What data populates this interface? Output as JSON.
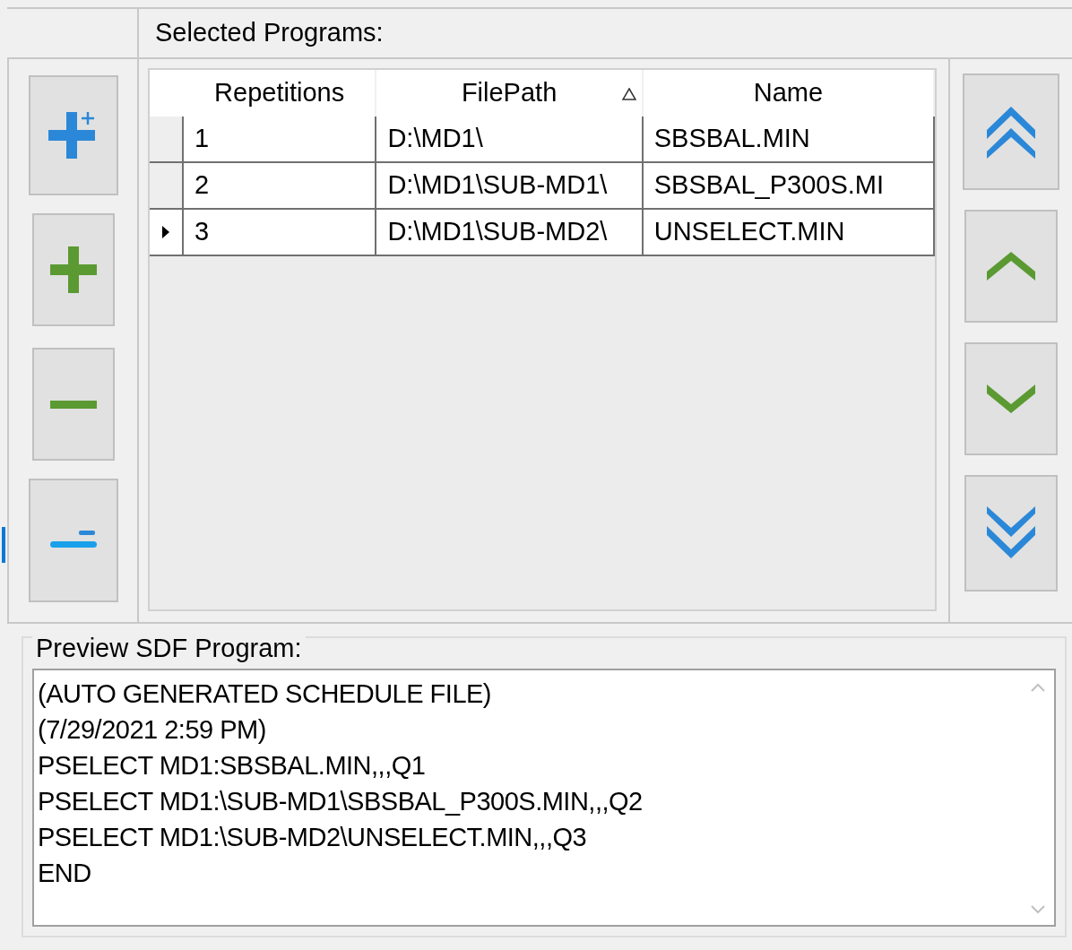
{
  "selected_programs": {
    "title": "Selected Programs:",
    "columns": [
      {
        "label": "Repetitions",
        "sorted": false
      },
      {
        "label": "FilePath",
        "sorted": true
      },
      {
        "label": "Name",
        "sorted": false
      }
    ],
    "rows": [
      {
        "cells": [
          "1",
          "D:\\MD1\\",
          "SBSBAL.MIN"
        ],
        "selected": false
      },
      {
        "cells": [
          "2",
          "D:\\MD1\\SUB-MD1\\",
          "SBSBAL_P300S.MI"
        ],
        "selected": false
      },
      {
        "cells": [
          "3",
          "D:\\MD1\\SUB-MD2\\",
          "UNSELECT.MIN"
        ],
        "selected": true
      }
    ]
  },
  "preview": {
    "title": "Preview SDF Program:",
    "lines": [
      "(AUTO GENERATED SCHEDULE FILE)",
      "(7/29/2021 2:59 PM)",
      "PSELECT MD1:SBSBAL.MIN,,,Q1",
      "PSELECT MD1:\\SUB-MD1\\SBSBAL_P300S.MIN,,,Q2",
      "PSELECT MD1:\\SUB-MD2\\UNSELECT.MIN,,,Q3",
      "END"
    ]
  }
}
